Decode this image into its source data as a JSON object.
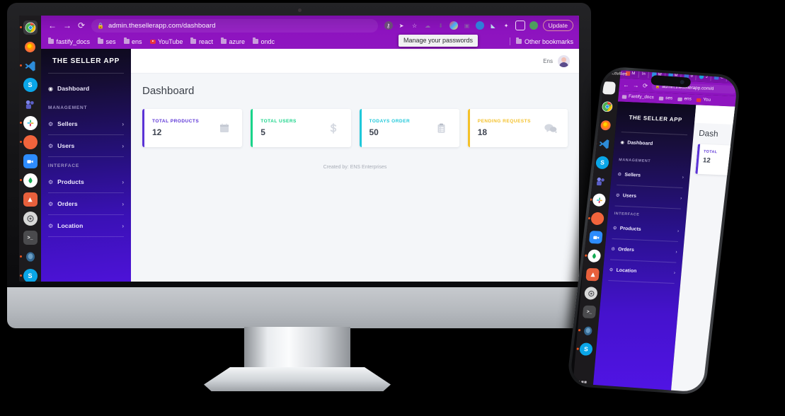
{
  "browser": {
    "url": "admin.thesellerapp.com/dashboard",
    "lock_icon": "lock-icon",
    "back_icon": "←",
    "forward_icon": "→",
    "reload_icon": "⟳",
    "update_button": "Update",
    "other_bookmarks": "Other bookmarks",
    "tooltip": "Manage your passwords",
    "bookmarks": [
      {
        "label": "fastify_docs",
        "icon": "folder-icon"
      },
      {
        "label": "ses",
        "icon": "folder-icon"
      },
      {
        "label": "ens",
        "icon": "folder-icon"
      },
      {
        "label": "YouTube",
        "icon": "youtube-icon"
      },
      {
        "label": "react",
        "icon": "folder-icon"
      },
      {
        "label": "azure",
        "icon": "folder-icon"
      },
      {
        "label": "ondc",
        "icon": "folder-icon"
      }
    ],
    "toolbar_icons": [
      "key-icon",
      "send-icon",
      "star-icon",
      "cloud-icon",
      "extension-puzzle-icon",
      "color-circle-icon",
      "tab-icon",
      "target-icon",
      "share-icon",
      "puzzle-icon",
      "square-icon",
      "globe-icon"
    ]
  },
  "dock": {
    "items": [
      {
        "name": "chrome",
        "glyph": "",
        "color": "#f2f2f2",
        "running": true,
        "active": true
      },
      {
        "name": "firefox",
        "glyph": "",
        "color": "#ff7139",
        "running": false
      },
      {
        "name": "vscode",
        "glyph": "",
        "color": "#2d8cd8",
        "running": true
      },
      {
        "name": "skype",
        "glyph": "S",
        "color": "#0aa6e8",
        "running": false
      },
      {
        "name": "teams",
        "glyph": "",
        "color": "#5b5fc7",
        "running": false
      },
      {
        "name": "slack",
        "glyph": "",
        "color": "#ffffff",
        "running": true
      },
      {
        "name": "firefox-dev",
        "glyph": "",
        "color": "#f2643c",
        "running": true
      },
      {
        "name": "zoom",
        "glyph": "",
        "color": "#2d8cff",
        "running": false
      },
      {
        "name": "mongodb",
        "glyph": "",
        "color": "#ffffff",
        "running": true
      },
      {
        "name": "android-studio",
        "glyph": "A",
        "color": "#e8603c",
        "running": false
      },
      {
        "name": "settings",
        "glyph": "",
        "color": "#cfcfcf",
        "running": false
      },
      {
        "name": "terminal",
        "glyph": ">_",
        "color": "#3c3c3c",
        "running": false
      },
      {
        "name": "postgresql",
        "glyph": "",
        "color": "#31648c",
        "running": true
      },
      {
        "name": "skype-2",
        "glyph": "S",
        "color": "#0aa6e8",
        "running": true
      }
    ]
  },
  "app": {
    "brand": "THE SELLER APP",
    "user_name": "Ens",
    "page_title": "Dashboard",
    "footer": "Created by: ENS Enterprises",
    "sidebar": {
      "dashboard": {
        "label": "Dashboard",
        "icon": "speedometer-icon"
      },
      "group_management": "MANAGEMENT",
      "group_interface": "INTERFACE",
      "items": [
        {
          "label": "Sellers",
          "icon": "gear-icon",
          "chevron": "›"
        },
        {
          "label": "Users",
          "icon": "gear-icon",
          "chevron": "›"
        },
        {
          "label": "Products",
          "icon": "gear-icon",
          "chevron": "›"
        },
        {
          "label": "Orders",
          "icon": "gear-icon",
          "chevron": "›"
        },
        {
          "label": "Location",
          "icon": "gear-icon",
          "chevron": "›"
        }
      ]
    },
    "cards": [
      {
        "label": "TOTAL PRODUCTS",
        "value": "12",
        "color": "#5b33d6",
        "icon": "calendar-icon"
      },
      {
        "label": "TOTAL USERS",
        "value": "5",
        "color": "#19d48a",
        "icon": "dollar-icon"
      },
      {
        "label": "TODAYS ORDER",
        "value": "50",
        "color": "#1fc8da",
        "icon": "clipboard-list-icon"
      },
      {
        "label": "PENDING REQUESTS",
        "value": "18",
        "color": "#f4c12a",
        "icon": "chat-bubbles-icon"
      }
    ]
  },
  "phone": {
    "activities": "Activities",
    "tabs": [
      {
        "label": "M",
        "color": "#e04a3a"
      },
      {
        "label": "In",
        "color": "#e04a3a"
      },
      {
        "label": "M",
        "color": "#2f8fe0"
      },
      {
        "label": "M",
        "color": "#2f8fe0"
      },
      {
        "label": "o",
        "color": "#3f6fd8"
      },
      {
        "label": "J",
        "color": "#1aa2d8"
      },
      {
        "label": "C",
        "color": "#3f6fd8"
      }
    ],
    "url": "admin.thesellerapp.com/d",
    "bookmarks": [
      "Fastify_docs",
      "ses",
      "ens",
      "You"
    ],
    "brand": "THE SELLER APP",
    "page_title": "Dash",
    "card": {
      "label": "TOTAL",
      "value": "12",
      "color": "#5b33d6"
    },
    "sidebar": {
      "dashboard": "Dashboard",
      "group_management": "MANAGEMENT",
      "group_interface": "INTERFACE",
      "items": [
        {
          "label": "Sellers",
          "chevron": "›"
        },
        {
          "label": "Users",
          "chevron": "›"
        },
        {
          "label": "Products",
          "chevron": "›"
        },
        {
          "label": "Orders",
          "chevron": "›"
        },
        {
          "label": "Location",
          "chevron": "›"
        }
      ]
    }
  }
}
